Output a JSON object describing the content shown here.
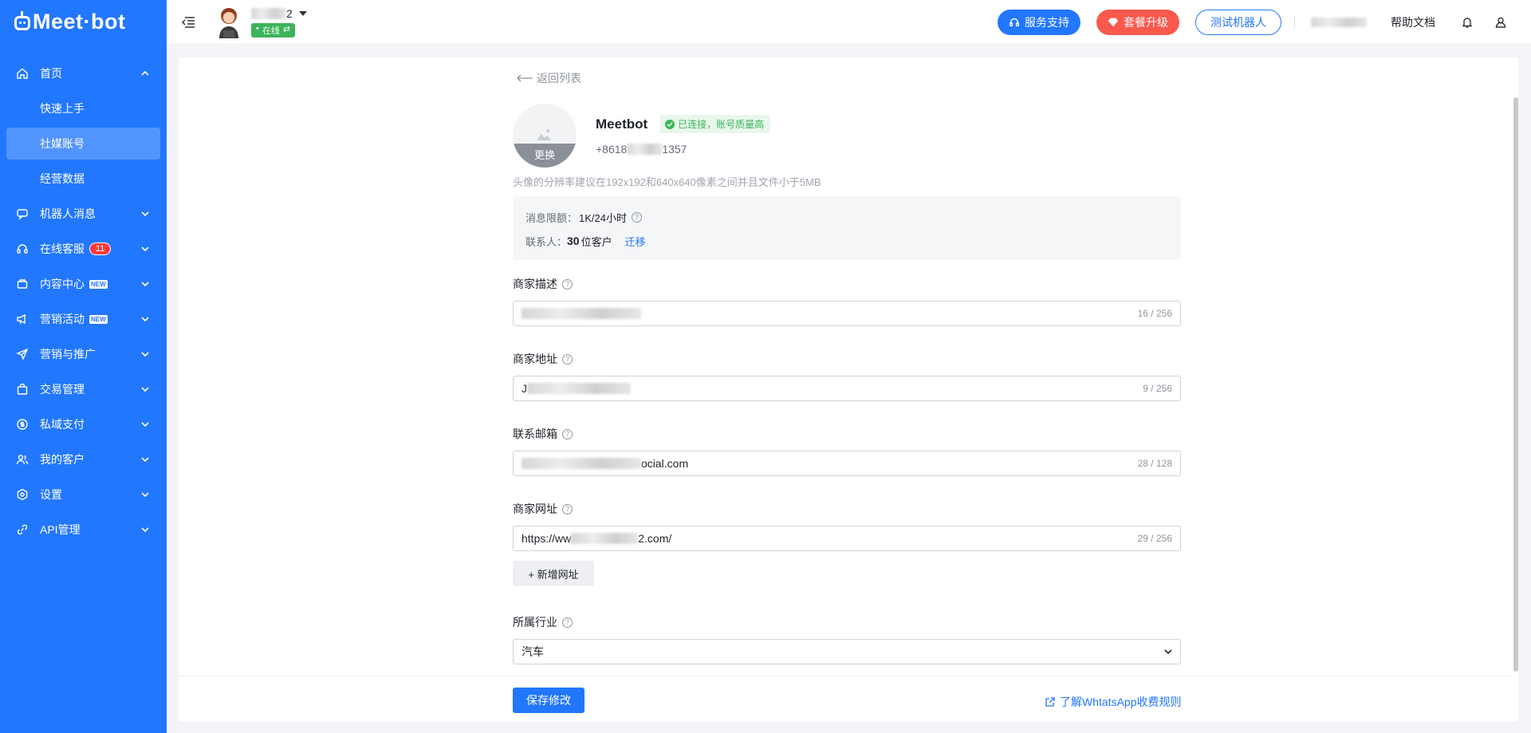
{
  "brand": {
    "logo_text": "Meet·bot"
  },
  "sidebar": {
    "items": [
      {
        "label": "首页",
        "icon": "home-icon",
        "expanded": true,
        "children": [
          {
            "label": "快速上手",
            "active": false
          },
          {
            "label": "社媒账号",
            "active": true
          },
          {
            "label": "经营数据",
            "active": false
          }
        ]
      },
      {
        "label": "机器人消息",
        "icon": "robot-chat-icon"
      },
      {
        "label": "在线客服",
        "icon": "headset-icon",
        "badge": "11"
      },
      {
        "label": "内容中心",
        "icon": "content-icon",
        "new": "NEW"
      },
      {
        "label": "营销活动",
        "icon": "megaphone-icon",
        "new": "NEW"
      },
      {
        "label": "营销与推广",
        "icon": "paper-plane-icon"
      },
      {
        "label": "交易管理",
        "icon": "shopping-bag-icon"
      },
      {
        "label": "私域支付",
        "icon": "dollar-circle-icon"
      },
      {
        "label": "我的客户",
        "icon": "users-icon"
      },
      {
        "label": "设置",
        "icon": "settings-icon"
      },
      {
        "label": "API管理",
        "icon": "api-icon"
      }
    ]
  },
  "topbar": {
    "account_name_suffix": "2",
    "account_status": "在线",
    "support_label": "服务支持",
    "upgrade_label": "套餐升级",
    "test_bot_label": "测试机器人",
    "help_docs_label": "帮助文档"
  },
  "page": {
    "back_label": "返回列表",
    "profile": {
      "name": "Meetbot",
      "connection_status": "已连接，账号质量高",
      "phone_prefix": "+8618",
      "phone_suffix": "1357",
      "change_avatar_label": "更换",
      "avatar_hint": "头像的分辨率建议在192x192和640x640像素之间并且文件小于5MB"
    },
    "quota": {
      "limit_label": "消息限额：",
      "limit_value": "1K/24小时",
      "contacts_label": "联系人：",
      "contacts_count": "30",
      "contacts_unit": "位客户",
      "migrate_label": "迁移"
    },
    "fields": {
      "description": {
        "label": "商家描述",
        "value": "",
        "count": "16 / 256"
      },
      "address": {
        "label": "商家地址",
        "value": "J",
        "count": "9 / 256"
      },
      "email": {
        "label": "联系邮箱",
        "value_suffix": "ocial.com",
        "count": "28 / 128"
      },
      "website": {
        "label": "商家网址",
        "value_prefix": "https://ww",
        "value_suffix": "2.com/",
        "count": "29 / 256"
      },
      "add_website_label": "+ 新增网址",
      "industry": {
        "label": "所属行业",
        "value": "汽车"
      }
    },
    "footer": {
      "save_label": "保存修改",
      "rules_link": "了解WhtatsApp收费规则"
    }
  },
  "colors": {
    "primary": "#2277ff",
    "upgrade": "#fa5a4e",
    "success": "#3cb45a"
  }
}
